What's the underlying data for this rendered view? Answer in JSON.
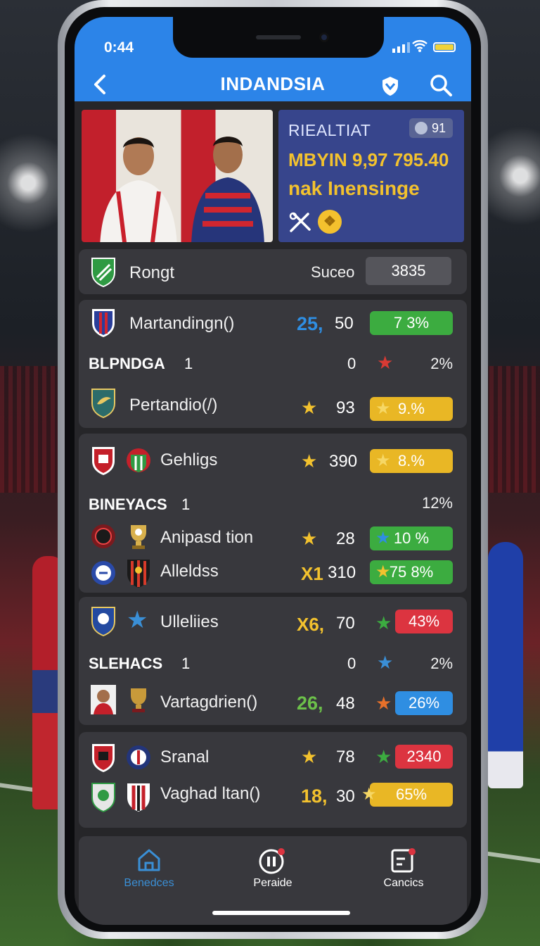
{
  "status_bar": {
    "time": "0:44"
  },
  "header": {
    "title": "INDANDSIA"
  },
  "promo": {
    "tag": "RIEALTIAT",
    "badge_count": "91",
    "line1": "MBYIN 9,97 795.40",
    "line2": "nak Inensinge",
    "coin_icon": "coin-icon"
  },
  "summary": {
    "team": "Rongt",
    "label": "Suceo",
    "value": "3835"
  },
  "cards": [
    {
      "rows": [
        {
          "type": "match",
          "name": "Martandingn()",
          "odd1": "25,",
          "odd2": "50",
          "pill": "7 3%",
          "pill_color": "#3cac40"
        },
        {
          "type": "header",
          "name": "BLPNDGA",
          "num": "1",
          "mid": "0",
          "pct": "2%",
          "star_color": "#d83a34"
        },
        {
          "type": "match",
          "name": "Pertandio(/)",
          "odd2": "93",
          "pill": "9.%",
          "pill_color": "#e9b725"
        }
      ]
    },
    {
      "rows": [
        {
          "type": "match",
          "name": "Gehligs",
          "odd2": "390",
          "pill": "8.%",
          "pill_color": "#e9b725"
        },
        {
          "type": "header",
          "name": "BINEYACS",
          "num": "1",
          "pct": "12%"
        },
        {
          "type": "match",
          "name": "Anipasd tion",
          "odd2": "28",
          "pill": "10 %",
          "pill_color": "#3cac40"
        },
        {
          "type": "match",
          "name": "Alleldss",
          "odd1": "X1",
          "odd2": "310",
          "pill": "75 8%",
          "pill_color": "#3cac40"
        }
      ]
    },
    {
      "rows": [
        {
          "type": "match",
          "name": "Ulleliies",
          "odd1": "X6,",
          "odd2": "70",
          "pill": "43%",
          "pill_color": "#dc3440"
        },
        {
          "type": "header",
          "name": "SLEHACS",
          "num": "1",
          "mid": "0",
          "pct": "2%"
        },
        {
          "type": "match",
          "name": "Vartagdrien()",
          "odd1": "26,",
          "odd2": "48",
          "pill": "26%",
          "pill_color": "#2f8ee2"
        }
      ]
    },
    {
      "rows": [
        {
          "type": "match",
          "name": "Sranal",
          "odd2": "78",
          "pill": "2340",
          "pill_color": "#dc3440"
        },
        {
          "type": "match",
          "name": "Vaghad ltan()",
          "odd1": "18,",
          "odd2": "30",
          "pill": "65%",
          "pill_color": "#e9b725"
        }
      ]
    }
  ],
  "tabs": [
    {
      "label": "Benedces",
      "icon": "home-icon",
      "active": true
    },
    {
      "label": "Peraide",
      "icon": "pause-icon",
      "active": false
    },
    {
      "label": "Cancics",
      "icon": "clipboard-icon",
      "active": false
    }
  ],
  "colors": {
    "accent": "#2c84e8",
    "green": "#3cac40",
    "yellow": "#e9b725",
    "red": "#dc3440",
    "blue": "#2f8ee2"
  }
}
